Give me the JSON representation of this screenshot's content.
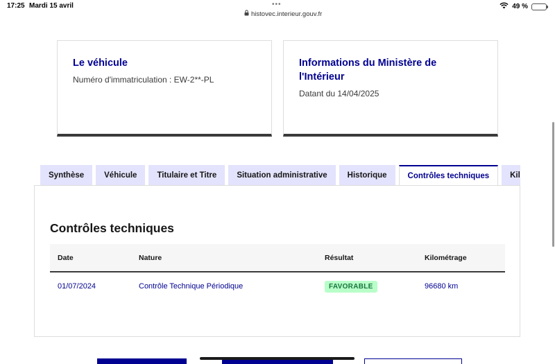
{
  "statusbar": {
    "time": "17:25",
    "date": "Mardi 15 avril",
    "dots": "•••",
    "url": "histovec.interieur.gouv.fr",
    "battery": "49 %",
    "battery_level": 0.49
  },
  "cards": {
    "vehicle": {
      "title": "Le véhicule",
      "text": "Numéro d'immatriculation : EW-2**-PL"
    },
    "ministry": {
      "title": "Informations du Ministère de l'Intérieur",
      "text": "Datant du 14/04/2025"
    }
  },
  "tabs": [
    {
      "label": "Synthèse"
    },
    {
      "label": "Véhicule"
    },
    {
      "label": "Titulaire et Titre"
    },
    {
      "label": "Situation administrative"
    },
    {
      "label": "Historique"
    },
    {
      "label": "Contrôles techniques"
    },
    {
      "label": "Kilométrage"
    }
  ],
  "active_tab": "Contrôles techniques",
  "panel": {
    "title": "Contrôles techniques",
    "columns": [
      "Date",
      "Nature",
      "Résultat",
      "Kilométrage"
    ],
    "rows": [
      {
        "date": "01/07/2024",
        "nature": "Contrôle Technique Périodique",
        "result": "FAVORABLE",
        "km": "96680 km"
      }
    ]
  },
  "colors": {
    "primary": "#000091",
    "tab_bg": "#e3e3fd",
    "badge_bg": "#b8fec9",
    "badge_text": "#18753c"
  }
}
